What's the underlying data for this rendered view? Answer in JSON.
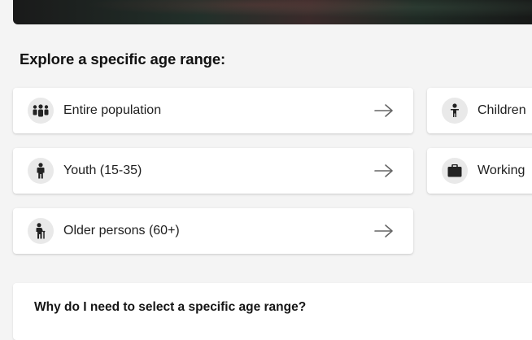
{
  "section": {
    "heading": "Explore a specific age range:"
  },
  "cards": {
    "entire_population": {
      "label": "Entire population",
      "icon": "group-icon"
    },
    "children": {
      "label": "Children",
      "icon": "child-icon"
    },
    "youth": {
      "label": "Youth (15-35)",
      "icon": "person-icon"
    },
    "working": {
      "label": "Working",
      "icon": "briefcase-icon"
    },
    "older_persons": {
      "label": "Older persons (60+)",
      "icon": "elderly-person-icon"
    }
  },
  "faq": {
    "question": "Why do I need to select a specific age range?"
  },
  "colors": {
    "background": "#f4f4f4",
    "card": "#ffffff",
    "icon_circle": "#e9e9e9",
    "text": "#202020",
    "arrow": "#666666"
  }
}
